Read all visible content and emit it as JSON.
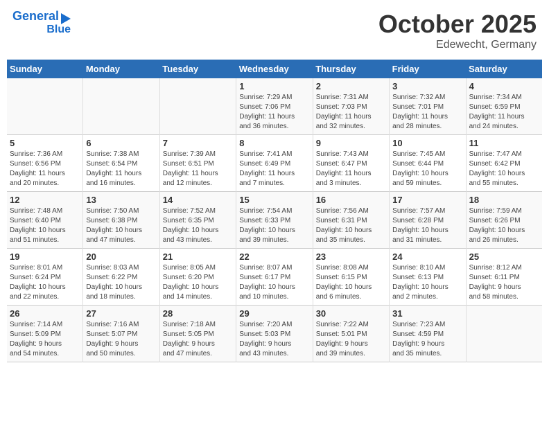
{
  "logo": {
    "line1": "General",
    "line2": "Blue"
  },
  "title": "October 2025",
  "subtitle": "Edewecht, Germany",
  "weekdays": [
    "Sunday",
    "Monday",
    "Tuesday",
    "Wednesday",
    "Thursday",
    "Friday",
    "Saturday"
  ],
  "weeks": [
    [
      {
        "day": "",
        "info": ""
      },
      {
        "day": "",
        "info": ""
      },
      {
        "day": "",
        "info": ""
      },
      {
        "day": "1",
        "info": "Sunrise: 7:29 AM\nSunset: 7:06 PM\nDaylight: 11 hours\nand 36 minutes."
      },
      {
        "day": "2",
        "info": "Sunrise: 7:31 AM\nSunset: 7:03 PM\nDaylight: 11 hours\nand 32 minutes."
      },
      {
        "day": "3",
        "info": "Sunrise: 7:32 AM\nSunset: 7:01 PM\nDaylight: 11 hours\nand 28 minutes."
      },
      {
        "day": "4",
        "info": "Sunrise: 7:34 AM\nSunset: 6:59 PM\nDaylight: 11 hours\nand 24 minutes."
      }
    ],
    [
      {
        "day": "5",
        "info": "Sunrise: 7:36 AM\nSunset: 6:56 PM\nDaylight: 11 hours\nand 20 minutes."
      },
      {
        "day": "6",
        "info": "Sunrise: 7:38 AM\nSunset: 6:54 PM\nDaylight: 11 hours\nand 16 minutes."
      },
      {
        "day": "7",
        "info": "Sunrise: 7:39 AM\nSunset: 6:51 PM\nDaylight: 11 hours\nand 12 minutes."
      },
      {
        "day": "8",
        "info": "Sunrise: 7:41 AM\nSunset: 6:49 PM\nDaylight: 11 hours\nand 7 minutes."
      },
      {
        "day": "9",
        "info": "Sunrise: 7:43 AM\nSunset: 6:47 PM\nDaylight: 11 hours\nand 3 minutes."
      },
      {
        "day": "10",
        "info": "Sunrise: 7:45 AM\nSunset: 6:44 PM\nDaylight: 10 hours\nand 59 minutes."
      },
      {
        "day": "11",
        "info": "Sunrise: 7:47 AM\nSunset: 6:42 PM\nDaylight: 10 hours\nand 55 minutes."
      }
    ],
    [
      {
        "day": "12",
        "info": "Sunrise: 7:48 AM\nSunset: 6:40 PM\nDaylight: 10 hours\nand 51 minutes."
      },
      {
        "day": "13",
        "info": "Sunrise: 7:50 AM\nSunset: 6:38 PM\nDaylight: 10 hours\nand 47 minutes."
      },
      {
        "day": "14",
        "info": "Sunrise: 7:52 AM\nSunset: 6:35 PM\nDaylight: 10 hours\nand 43 minutes."
      },
      {
        "day": "15",
        "info": "Sunrise: 7:54 AM\nSunset: 6:33 PM\nDaylight: 10 hours\nand 39 minutes."
      },
      {
        "day": "16",
        "info": "Sunrise: 7:56 AM\nSunset: 6:31 PM\nDaylight: 10 hours\nand 35 minutes."
      },
      {
        "day": "17",
        "info": "Sunrise: 7:57 AM\nSunset: 6:28 PM\nDaylight: 10 hours\nand 31 minutes."
      },
      {
        "day": "18",
        "info": "Sunrise: 7:59 AM\nSunset: 6:26 PM\nDaylight: 10 hours\nand 26 minutes."
      }
    ],
    [
      {
        "day": "19",
        "info": "Sunrise: 8:01 AM\nSunset: 6:24 PM\nDaylight: 10 hours\nand 22 minutes."
      },
      {
        "day": "20",
        "info": "Sunrise: 8:03 AM\nSunset: 6:22 PM\nDaylight: 10 hours\nand 18 minutes."
      },
      {
        "day": "21",
        "info": "Sunrise: 8:05 AM\nSunset: 6:20 PM\nDaylight: 10 hours\nand 14 minutes."
      },
      {
        "day": "22",
        "info": "Sunrise: 8:07 AM\nSunset: 6:17 PM\nDaylight: 10 hours\nand 10 minutes."
      },
      {
        "day": "23",
        "info": "Sunrise: 8:08 AM\nSunset: 6:15 PM\nDaylight: 10 hours\nand 6 minutes."
      },
      {
        "day": "24",
        "info": "Sunrise: 8:10 AM\nSunset: 6:13 PM\nDaylight: 10 hours\nand 2 minutes."
      },
      {
        "day": "25",
        "info": "Sunrise: 8:12 AM\nSunset: 6:11 PM\nDaylight: 9 hours\nand 58 minutes."
      }
    ],
    [
      {
        "day": "26",
        "info": "Sunrise: 7:14 AM\nSunset: 5:09 PM\nDaylight: 9 hours\nand 54 minutes."
      },
      {
        "day": "27",
        "info": "Sunrise: 7:16 AM\nSunset: 5:07 PM\nDaylight: 9 hours\nand 50 minutes."
      },
      {
        "day": "28",
        "info": "Sunrise: 7:18 AM\nSunset: 5:05 PM\nDaylight: 9 hours\nand 47 minutes."
      },
      {
        "day": "29",
        "info": "Sunrise: 7:20 AM\nSunset: 5:03 PM\nDaylight: 9 hours\nand 43 minutes."
      },
      {
        "day": "30",
        "info": "Sunrise: 7:22 AM\nSunset: 5:01 PM\nDaylight: 9 hours\nand 39 minutes."
      },
      {
        "day": "31",
        "info": "Sunrise: 7:23 AM\nSunset: 4:59 PM\nDaylight: 9 hours\nand 35 minutes."
      },
      {
        "day": "",
        "info": ""
      }
    ]
  ]
}
